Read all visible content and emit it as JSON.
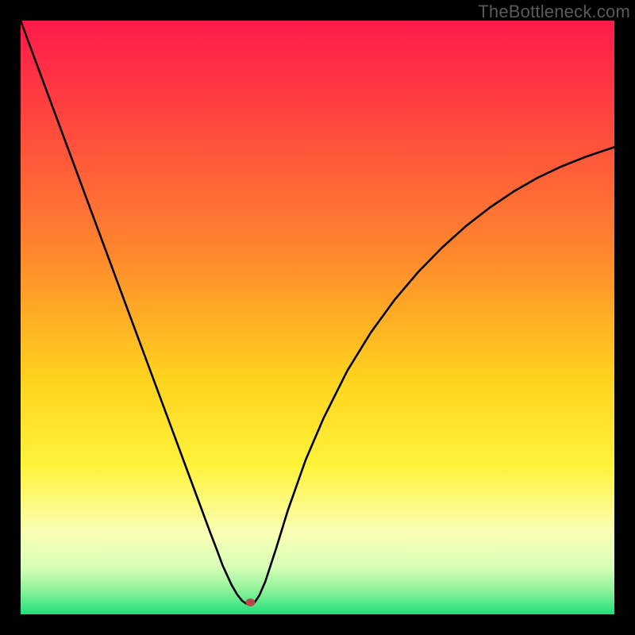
{
  "watermark": {
    "text": "TheBottleneck.com"
  },
  "chart_data": {
    "type": "line",
    "title": "",
    "xlabel": "",
    "ylabel": "",
    "xlim": [
      0,
      100
    ],
    "ylim": [
      0,
      100
    ],
    "grid": false,
    "legend": false,
    "gradient_stops": [
      {
        "offset": 0.0,
        "color": "#ff1a4b"
      },
      {
        "offset": 0.2,
        "color": "#ff4f3c"
      },
      {
        "offset": 0.4,
        "color": "#ff8a2d"
      },
      {
        "offset": 0.6,
        "color": "#ffd21e"
      },
      {
        "offset": 0.75,
        "color": "#fff33a"
      },
      {
        "offset": 0.86,
        "color": "#faffb4"
      },
      {
        "offset": 0.92,
        "color": "#d8ffb8"
      },
      {
        "offset": 0.96,
        "color": "#8cf29a"
      },
      {
        "offset": 1.0,
        "color": "#1fe07a"
      }
    ],
    "marker": {
      "x": 38.7,
      "y": 2.0,
      "color": "#b54a4a"
    },
    "series": [
      {
        "name": "curve",
        "x": [
          0,
          2,
          4,
          6,
          8,
          10,
          12,
          14,
          16,
          18,
          20,
          22,
          24,
          26,
          28,
          30,
          32,
          33,
          34,
          35.5,
          36.5,
          37.3,
          38.0,
          38.7,
          39.4,
          40.2,
          41.2,
          43,
          45,
          48,
          51,
          55,
          59,
          63,
          67,
          71,
          75,
          79,
          83,
          87,
          91,
          95,
          100
        ],
        "y": [
          100,
          94.6,
          89.2,
          83.8,
          78.4,
          73.0,
          67.6,
          62.2,
          56.8,
          51.4,
          46.0,
          40.6,
          35.2,
          29.8,
          24.4,
          19.0,
          13.6,
          11.0,
          8.3,
          5.0,
          3.3,
          2.3,
          1.8,
          1.7,
          2.0,
          3.2,
          5.5,
          11.0,
          17.5,
          26.0,
          33.0,
          41.0,
          47.5,
          53.0,
          57.7,
          61.8,
          65.4,
          68.5,
          71.2,
          73.5,
          75.4,
          77.0,
          78.7
        ]
      }
    ]
  }
}
